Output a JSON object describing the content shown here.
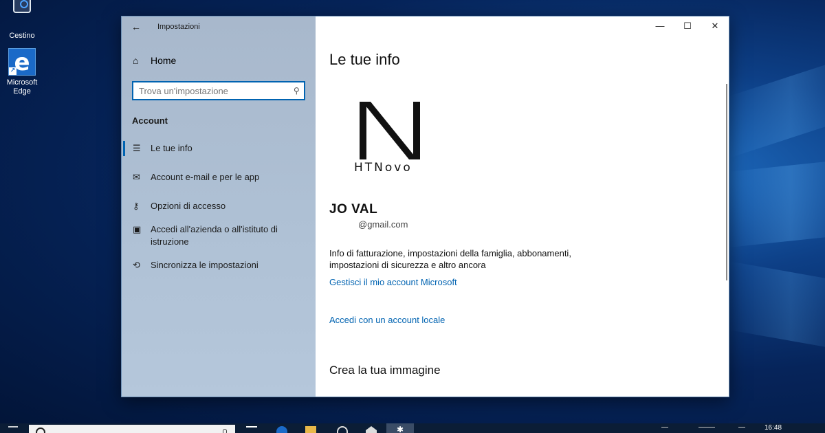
{
  "desktop": {
    "icons": [
      {
        "label": "Cestino",
        "icon": "recycle-bin-icon"
      },
      {
        "label": "Microsoft\nEdge",
        "icon": "edge-icon"
      }
    ]
  },
  "window": {
    "title": "Impostazioni",
    "controls": {
      "minimize": "—",
      "maximize": "☐",
      "close": "✕"
    }
  },
  "nav": {
    "back_glyph": "←",
    "home": {
      "label": "Home",
      "icon": "home-icon",
      "glyph": "⌂"
    },
    "search": {
      "placeholder": "Trova un'impostazione",
      "icon": "search-icon",
      "glyph": "⚲"
    },
    "section": "Account",
    "items": [
      {
        "label": "Le tue info",
        "icon": "person-card-icon",
        "glyph": "☰",
        "selected": true
      },
      {
        "label": "Account e-mail e per le app",
        "icon": "mail-icon",
        "glyph": "✉"
      },
      {
        "label": "Opzioni di accesso",
        "icon": "key-icon",
        "glyph": "⚷"
      },
      {
        "label": "Accedi all'azienda o all'istituto di istruzione",
        "icon": "briefcase-icon",
        "glyph": "▣"
      },
      {
        "label": "Sincronizza le impostazioni",
        "icon": "sync-icon",
        "glyph": "⟲"
      }
    ]
  },
  "content": {
    "title": "Le tue info",
    "avatar": {
      "logo_letter": "N",
      "brand": "HTNovo"
    },
    "user_name": "JO VAL",
    "user_email": "@gmail.com",
    "description": "Info di fatturazione, impostazioni della famiglia, abbonamenti, impostazioni di sicurezza e altro ancora",
    "link_manage": "Gestisci il mio account Microsoft",
    "link_local": "Accedi con un account locale",
    "section_picture": "Crea la tua immagine"
  },
  "taskbar": {
    "clock": "16:48"
  },
  "colors": {
    "accent": "#0063b1",
    "nav_bg": "#aec0d4"
  }
}
